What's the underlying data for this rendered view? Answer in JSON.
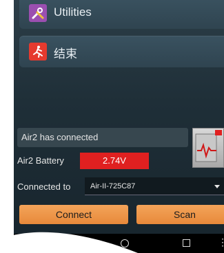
{
  "menu": {
    "items": [
      {
        "label": "Utilities",
        "icon": "tools-icon",
        "color": "#9b4fb0"
      },
      {
        "label": "结束",
        "icon": "exit-running-man-icon",
        "color": "#e63a2e"
      }
    ]
  },
  "status": {
    "connection_text": "Air2 has connected",
    "battery_label": "Air2 Battery",
    "battery_value": "2.74V",
    "battery_color": "#e02020"
  },
  "connection": {
    "label": "Connected to",
    "selected_device": "Air-II-725C87"
  },
  "buttons": {
    "connect": "Connect",
    "scan": "Scan"
  },
  "colors": {
    "button_orange": "#ee9646",
    "background": "#1f2f38"
  }
}
